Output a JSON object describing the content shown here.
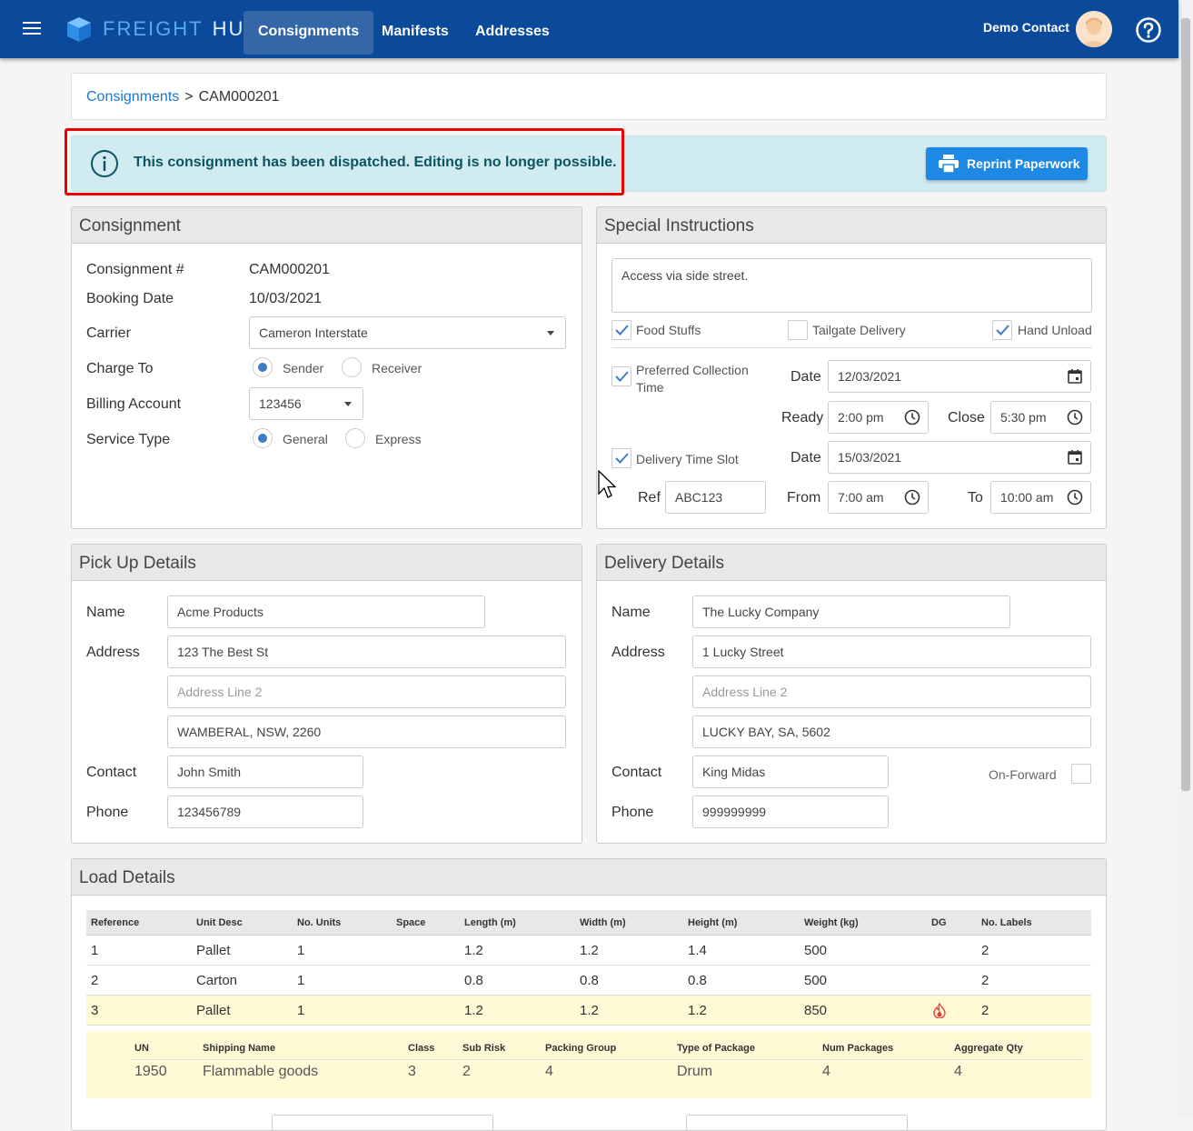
{
  "app": {
    "logo_part1": "FREIGHT",
    "logo_part2": "HUB",
    "nav": [
      "Consignments",
      "Manifests",
      "Addresses"
    ],
    "user_name": "Demo Contact"
  },
  "breadcrumb": {
    "root": "Consignments",
    "separator": ">",
    "current": "CAM000201"
  },
  "alert": {
    "message": "This consignment has been dispatched. Editing is no longer possible.",
    "button": "Reprint Paperwork"
  },
  "consignment": {
    "title": "Consignment",
    "labels": {
      "number": "Consignment #",
      "booking_date": "Booking Date",
      "carrier": "Carrier",
      "charge_to": "Charge To",
      "billing_account": "Billing Account",
      "service_type": "Service Type"
    },
    "number": "CAM000201",
    "booking_date": "10/03/2021",
    "carrier": "Cameron Interstate",
    "charge_options": [
      "Sender",
      "Receiver"
    ],
    "charge_selected": "Sender",
    "billing_account": "123456",
    "service_options": [
      "General",
      "Express"
    ],
    "service_selected": "General"
  },
  "special": {
    "title": "Special Instructions",
    "notes": "Access via side street.",
    "food_stuffs": "Food Stuffs",
    "tailgate": "Tailgate Delivery",
    "hand_unload": "Hand Unload",
    "pref_collection": "Preferred Collection Time",
    "date_label": "Date",
    "collection_date": "12/03/2021",
    "ready_label": "Ready",
    "ready_time": "2:00 pm",
    "close_label": "Close",
    "close_time": "5:30 pm",
    "delivery_slot": "Delivery Time Slot",
    "delivery_date": "15/03/2021",
    "ref_label": "Ref",
    "ref_value": "ABC123",
    "from_label": "From",
    "from_time": "7:00 am",
    "to_label": "To",
    "to_time": "10:00 am",
    "checked": {
      "food_stuffs": true,
      "tailgate": false,
      "hand_unload": true,
      "pref_collection": true,
      "delivery_slot": true
    }
  },
  "pickup": {
    "title": "Pick Up Details",
    "labels": {
      "name": "Name",
      "address": "Address",
      "contact": "Contact",
      "phone": "Phone"
    },
    "name": "Acme Products",
    "address1": "123 The Best St",
    "address2_placeholder": "Address Line 2",
    "address3": "WAMBERAL, NSW, 2260",
    "contact": "John Smith",
    "phone": "123456789"
  },
  "delivery": {
    "title": "Delivery Details",
    "labels": {
      "name": "Name",
      "address": "Address",
      "contact": "Contact",
      "phone": "Phone",
      "on_forward": "On-Forward"
    },
    "name": "The Lucky Company",
    "address1": "1 Lucky Street",
    "address2_placeholder": "Address Line 2",
    "address3": "LUCKY BAY, SA, 5602",
    "contact": "King Midas",
    "phone": "999999999"
  },
  "load": {
    "title": "Load Details",
    "columns": [
      "Reference",
      "Unit Desc",
      "No. Units",
      "Space",
      "Length (m)",
      "Width (m)",
      "Height (m)",
      "Weight (kg)",
      "DG",
      "No. Labels"
    ],
    "rows": [
      [
        "1",
        "Pallet",
        "1",
        "",
        "1.2",
        "1.2",
        "1.4",
        "500",
        "",
        "2"
      ],
      [
        "2",
        "Carton",
        "1",
        "",
        "0.8",
        "0.8",
        "0.8",
        "500",
        "",
        "2"
      ],
      [
        "3",
        "Pallet",
        "1",
        "",
        "1.2",
        "1.2",
        "1.2",
        "850",
        "",
        "2"
      ]
    ],
    "dg_columns": [
      "UN",
      "Shipping Name",
      "Class",
      "Sub Risk",
      "Packing Group",
      "Type of Package",
      "Num Packages",
      "Aggregate Qty"
    ],
    "dg_row": [
      "1950",
      "Flammable goods",
      "3",
      "2",
      "4",
      "Drum",
      "4",
      "4"
    ]
  },
  "colors": {
    "nav_bg": "#0b4a9b",
    "accent": "#1e88e5",
    "alert_bg": "#d1ecf1",
    "dg_highlight": "#fff9d6",
    "dg_icon": "#e53935"
  }
}
